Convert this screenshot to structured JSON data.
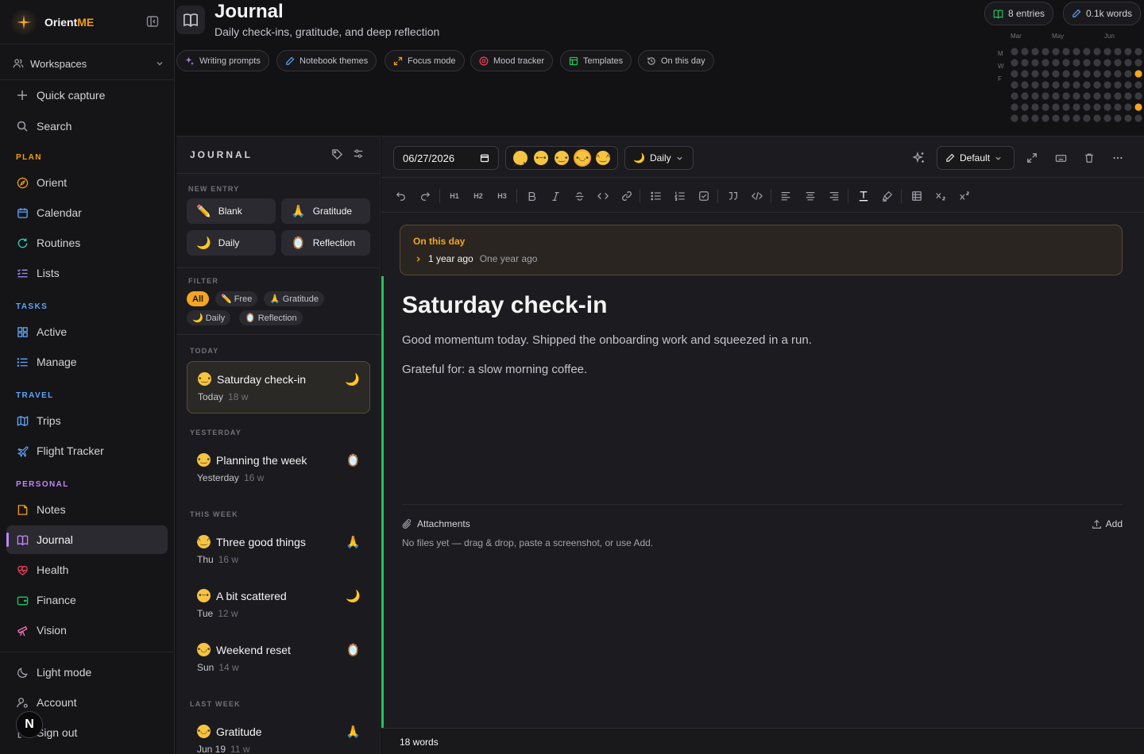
{
  "brand": {
    "name_prefix": "Orient",
    "name_suffix": "ME"
  },
  "sidebar": {
    "workspaces_label": "Workspaces",
    "quick_capture": "Quick capture",
    "search": "Search",
    "sections": {
      "plan": "PLAN",
      "tasks": "TASKS",
      "travel": "TRAVEL",
      "personal": "PERSONAL"
    },
    "section_colors": {
      "plan": "#f59e0b",
      "tasks": "#60a5fa",
      "travel": "#60a5fa",
      "personal": "#c084fc"
    },
    "items": {
      "orient": "Orient",
      "calendar": "Calendar",
      "routines": "Routines",
      "lists": "Lists",
      "active": "Active",
      "manage": "Manage",
      "trips": "Trips",
      "flight_tracker": "Flight Tracker",
      "notes": "Notes",
      "journal": "Journal",
      "health": "Health",
      "finance": "Finance",
      "vision": "Vision"
    },
    "bottom": {
      "light_mode": "Light mode",
      "account": "Account",
      "sign_out": "Sign out"
    },
    "avatar_letter": "N"
  },
  "header": {
    "title": "Journal",
    "subtitle": "Daily check-ins, gratitude, and deep reflection",
    "stats": {
      "entries": "8 entries",
      "words": "0.1k words"
    },
    "chips": {
      "writing_prompts": "Writing prompts",
      "notebook_themes": "Notebook themes",
      "focus_mode": "Focus mode",
      "mood_tracker": "Mood tracker",
      "templates": "Templates",
      "on_this_day": "On this day"
    }
  },
  "heatmap": {
    "months": [
      "Mar",
      "May",
      "Jun"
    ],
    "days": [
      "M",
      "W",
      "F"
    ],
    "colors": {
      "empty": "#3a3a40",
      "filled": "#f5a524"
    }
  },
  "list_panel": {
    "title": "JOURNAL",
    "new_entry_label": "NEW ENTRY",
    "new_entry": {
      "blank": "Blank",
      "gratitude": "Gratitude",
      "daily": "Daily",
      "reflection": "Reflection"
    },
    "filter_label": "FILTER",
    "filters": {
      "all": "All",
      "free": "Free",
      "gratitude": "Gratitude",
      "daily": "Daily",
      "reflection": "Reflection"
    },
    "groups": {
      "today": "TODAY",
      "yesterday": "YESTERDAY",
      "this_week": "THIS WEEK",
      "last_week": "LAST WEEK"
    },
    "entries": [
      {
        "title": "Saturday check-in",
        "date": "Today",
        "words": "18 w",
        "type": "daily"
      },
      {
        "title": "Planning the week",
        "date": "Yesterday",
        "words": "16 w",
        "type": "reflection"
      },
      {
        "title": "Three good things",
        "date": "Thu",
        "words": "16 w",
        "type": "gratitude"
      },
      {
        "title": "A bit scattered",
        "date": "Tue",
        "words": "12 w",
        "type": "daily"
      },
      {
        "title": "Weekend reset",
        "date": "Sun",
        "words": "14 w",
        "type": "reflection"
      },
      {
        "title": "Gratitude",
        "date": "Jun 19",
        "words": "11 w",
        "type": "gratitude"
      }
    ]
  },
  "editor": {
    "date": "06/27/2026",
    "entry_type": "Daily",
    "theme": "Default",
    "toolbar_headings": {
      "h1": "H1",
      "h2": "H2",
      "h3": "H3"
    },
    "on_this_day": {
      "title": "On this day",
      "item_primary": "1 year ago",
      "item_secondary": "One year ago"
    },
    "doc_title": "Saturday check-in",
    "paragraphs": [
      "Good momentum today. Shipped the onboarding work and squeezed in a run.",
      "Grateful for: a slow morning coffee."
    ],
    "attachments": {
      "label": "Attachments",
      "add": "Add",
      "empty": "No files yet — drag & drop, paste a screenshot, or use Add."
    },
    "word_count": "18 words"
  }
}
